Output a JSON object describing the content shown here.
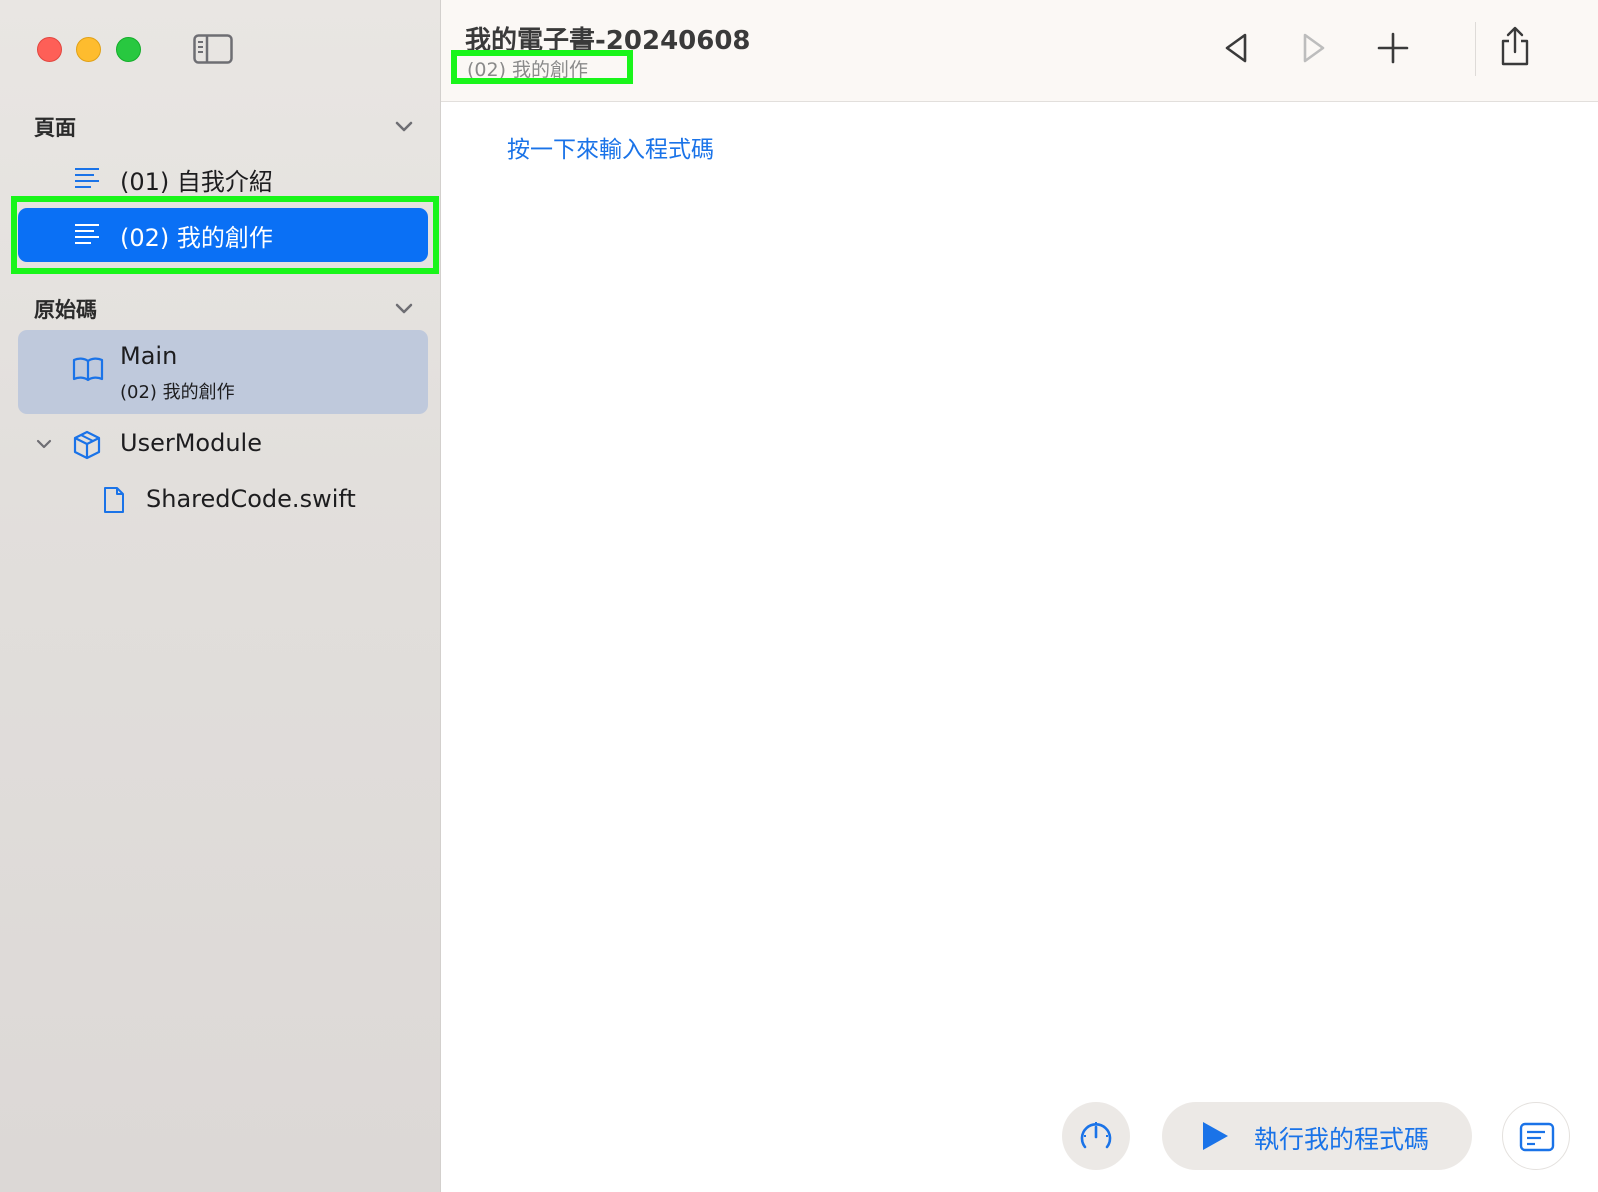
{
  "window": {
    "title": "我的電子書-20240608",
    "subtitle": "(02) 我的創作"
  },
  "sidebar": {
    "pages_header": "頁面",
    "pages": [
      {
        "label": "(01) 自我介紹",
        "selected": false
      },
      {
        "label": "(02) 我的創作",
        "selected": true
      }
    ],
    "source_header": "原始碼",
    "main": {
      "title": "Main",
      "subtitle": "(02) 我的創作"
    },
    "module": {
      "label": "UserModule"
    },
    "file": {
      "label": "SharedCode.swift"
    }
  },
  "editor": {
    "placeholder": "按一下來輸入程式碼"
  },
  "bottom": {
    "run_label": "執行我的程式碼"
  },
  "colors": {
    "accent": "#0a70f5",
    "link": "#1a73e8",
    "highlight": "#19f51a"
  },
  "icons": {
    "sidebar_toggle": "sidebar-toggle-icon",
    "page": "text-lines-icon",
    "main": "book-icon",
    "module": "cube-icon",
    "file": "document-icon",
    "back": "triangle-left-icon",
    "forward": "triangle-right-icon",
    "add": "plus-icon",
    "share": "share-icon",
    "gauge": "speedometer-icon",
    "run": "play-icon",
    "console": "console-icon"
  }
}
